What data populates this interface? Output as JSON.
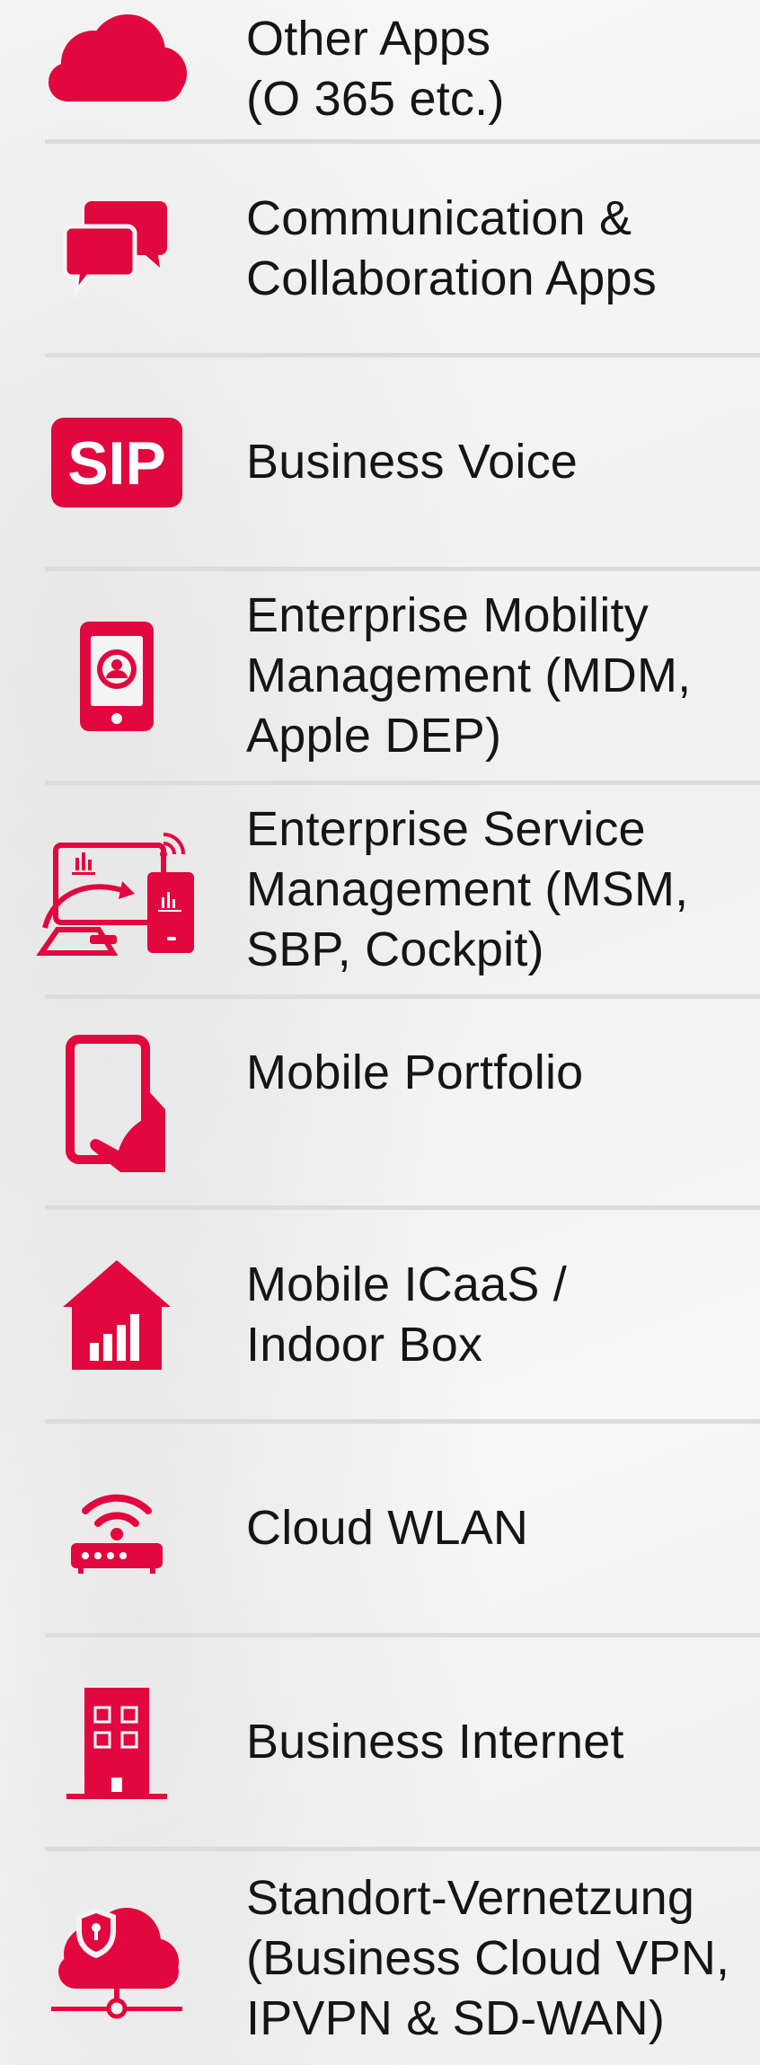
{
  "accent_color": "#e2073e",
  "items": [
    {
      "icon": "cloud-icon",
      "label": "Other Apps\n(O 365 etc.)"
    },
    {
      "icon": "chat-bubbles-icon",
      "label": "Communication &\nCollaboration Apps"
    },
    {
      "icon": "sip-icon",
      "icon_text": "SIP",
      "label": "Business Voice"
    },
    {
      "icon": "mobile-device-management-icon",
      "label": "Enterprise Mobility\nManagement (MDM,\nApple DEP)"
    },
    {
      "icon": "service-management-devices-icon",
      "label": "Enterprise Service\nManagement (MSM,\nSBP, Cockpit)"
    },
    {
      "icon": "hand-holding-phone-icon",
      "label": "Mobile Portfolio"
    },
    {
      "icon": "house-signal-icon",
      "label": "Mobile ICaaS /\nIndoor Box"
    },
    {
      "icon": "wifi-router-icon",
      "label": "Cloud WLAN"
    },
    {
      "icon": "office-building-icon",
      "label": "Business Internet"
    },
    {
      "icon": "cloud-security-network-icon",
      "label": "Standort-Vernetzung\n(Business Cloud VPN,\nIPVPN & SD-WAN)"
    }
  ]
}
